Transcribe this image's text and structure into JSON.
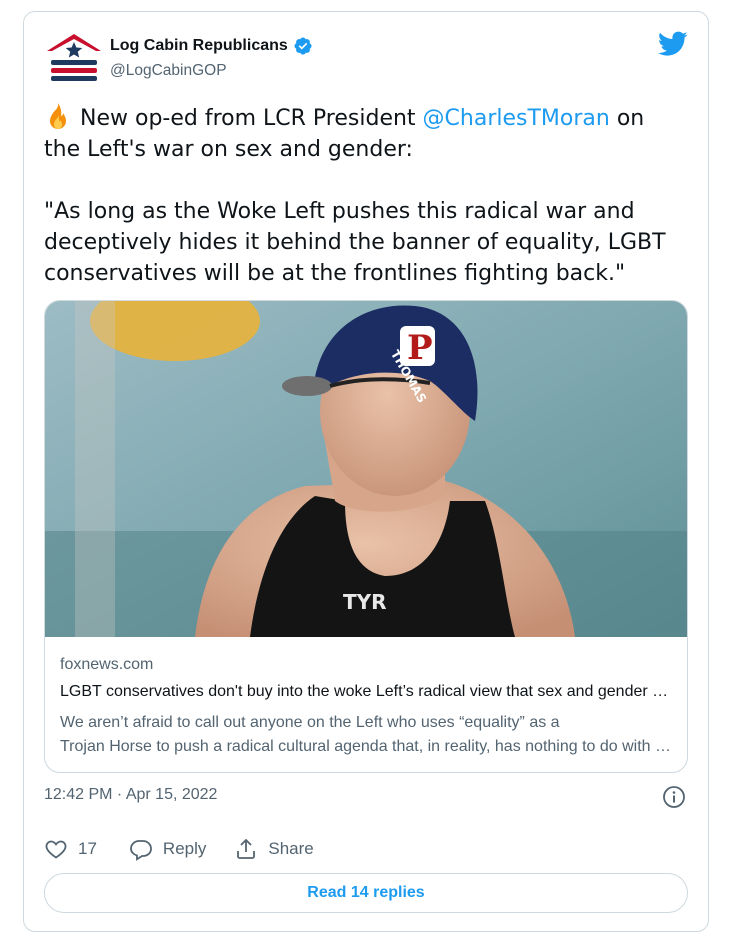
{
  "author": {
    "name": "Log Cabin Republicans",
    "handle": "@LogCabinGOP",
    "verified": true
  },
  "tweet": {
    "line1_rest_before_mention": "New op-ed from LCR President ",
    "mention": "@CharlesTMoran",
    "line1_after_mention": " on the Left's war on sex and gender:",
    "quote": "\"As long as the Woke Left pushes this radical war and deceptively hides it behind the banner of equality, LGBT conservatives will be at the frontlines fighting back.\""
  },
  "link_card": {
    "image_alt": "Swimmer in a navy swim cap reading THOMAS and TYR swimsuit",
    "cap_text": "THOMAS",
    "suit_text": "TYR",
    "domain": "foxnews.com",
    "title": "LGBT conservatives don't buy into the woke Left’s radical view that sex and gender are meaningless",
    "description_line1": "We aren’t afraid to call out anyone on the Left who uses “equality” as a",
    "description_line2": "Trojan Horse to push a radical cultural agenda that, in reality, has nothing to do with equality."
  },
  "meta": {
    "timestamp": "12:42 PM · Apr 15, 2022"
  },
  "actions": {
    "like_count": "17",
    "reply_label": "Reply",
    "share_label": "Share"
  },
  "read_replies_label": "Read 14 replies",
  "colors": {
    "accent": "#1d9bf0",
    "text": "#0f1419",
    "secondary": "#536471",
    "border": "#cfd9de"
  },
  "icons": [
    "house-flag-logo-icon",
    "verified-badge-icon",
    "twitter-bird-icon",
    "fire-emoji-icon",
    "info-icon",
    "heart-icon",
    "reply-bubble-icon",
    "share-icon"
  ]
}
